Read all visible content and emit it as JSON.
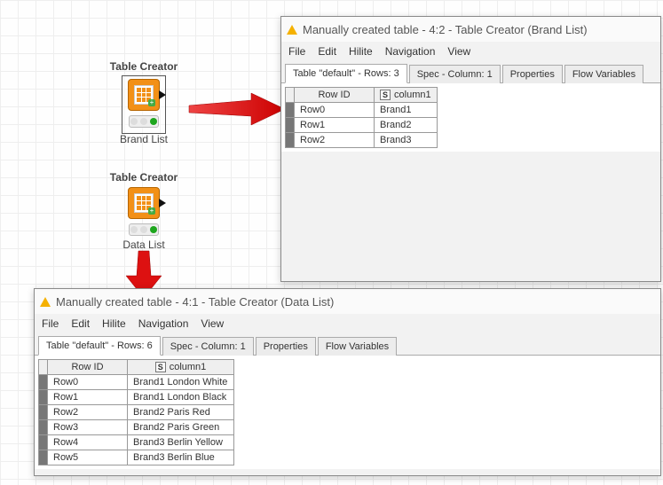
{
  "nodes": {
    "brand": {
      "type": "Table Creator",
      "name": "Brand List"
    },
    "data": {
      "type": "Table Creator",
      "name": "Data List"
    }
  },
  "win_brand": {
    "title": "Manually created table - 4:2 - Table Creator (Brand List)",
    "menu": [
      "File",
      "Edit",
      "Hilite",
      "Navigation",
      "View"
    ],
    "tabs": [
      "Table \"default\" - Rows: 3",
      "Spec - Column: 1",
      "Properties",
      "Flow Variables"
    ],
    "columns": [
      "Row ID",
      "column1"
    ],
    "s_label": "S",
    "rows": [
      {
        "id": "Row0",
        "c1": "Brand1"
      },
      {
        "id": "Row1",
        "c1": "Brand2"
      },
      {
        "id": "Row2",
        "c1": "Brand3"
      }
    ]
  },
  "win_data": {
    "title": "Manually created table - 4:1 - Table Creator (Data List)",
    "menu": [
      "File",
      "Edit",
      "Hilite",
      "Navigation",
      "View"
    ],
    "tabs": [
      "Table \"default\" - Rows: 6",
      "Spec - Column: 1",
      "Properties",
      "Flow Variables"
    ],
    "columns": [
      "Row ID",
      "column1"
    ],
    "s_label": "S",
    "rows": [
      {
        "id": "Row0",
        "c1": "Brand1 London White"
      },
      {
        "id": "Row1",
        "c1": "Brand1 London Black"
      },
      {
        "id": "Row2",
        "c1": "Brand2 Paris Red"
      },
      {
        "id": "Row3",
        "c1": "Brand2 Paris Green"
      },
      {
        "id": "Row4",
        "c1": "Brand3 Berlin Yellow"
      },
      {
        "id": "Row5",
        "c1": "Brand3 Berlin Blue"
      }
    ]
  }
}
